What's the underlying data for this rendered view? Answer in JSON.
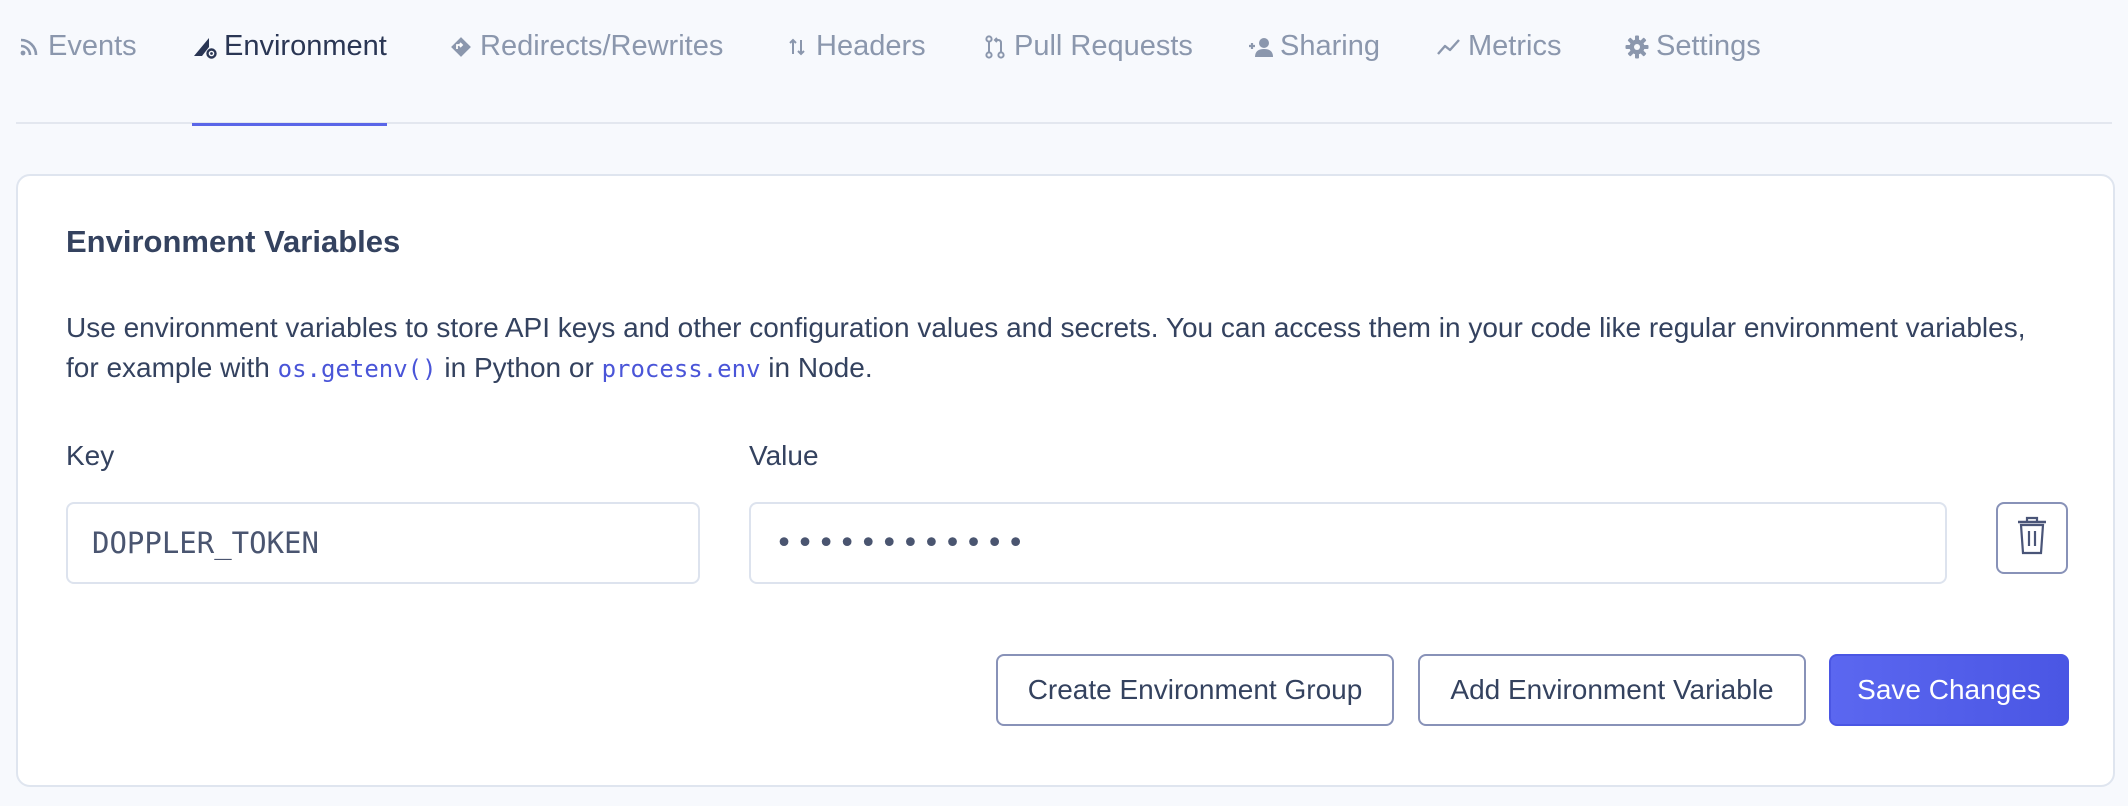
{
  "tabs": [
    {
      "label": "Events",
      "icon": "rss-icon"
    },
    {
      "label": "Environment",
      "icon": "environment-icon",
      "active": true
    },
    {
      "label": "Redirects/Rewrites",
      "icon": "diamond-arrow-icon"
    },
    {
      "label": "Headers",
      "icon": "up-down-arrows-icon"
    },
    {
      "label": "Pull Requests",
      "icon": "pull-request-icon"
    },
    {
      "label": "Sharing",
      "icon": "add-user-icon"
    },
    {
      "label": "Metrics",
      "icon": "trend-line-icon"
    },
    {
      "label": "Settings",
      "icon": "gear-icon"
    }
  ],
  "card": {
    "title": "Environment Variables",
    "description_1": "Use environment variables to store API keys and other configuration values and secrets. You can access them in your code like regular environment variables, for example with ",
    "code_1": "os.getenv()",
    "description_2": " in Python or ",
    "code_2": "process.env",
    "description_3": " in Node."
  },
  "form": {
    "key_label": "Key",
    "value_label": "Value",
    "key_value": "DOPPLER_TOKEN",
    "value_masked": "••••••••••••"
  },
  "buttons": {
    "create_group": "Create Environment Group",
    "add_variable": "Add Environment Variable",
    "save": "Save Changes"
  },
  "colors": {
    "accent": "#5a66e8",
    "muted_tab": "#8b97ad",
    "text": "#34425f"
  }
}
